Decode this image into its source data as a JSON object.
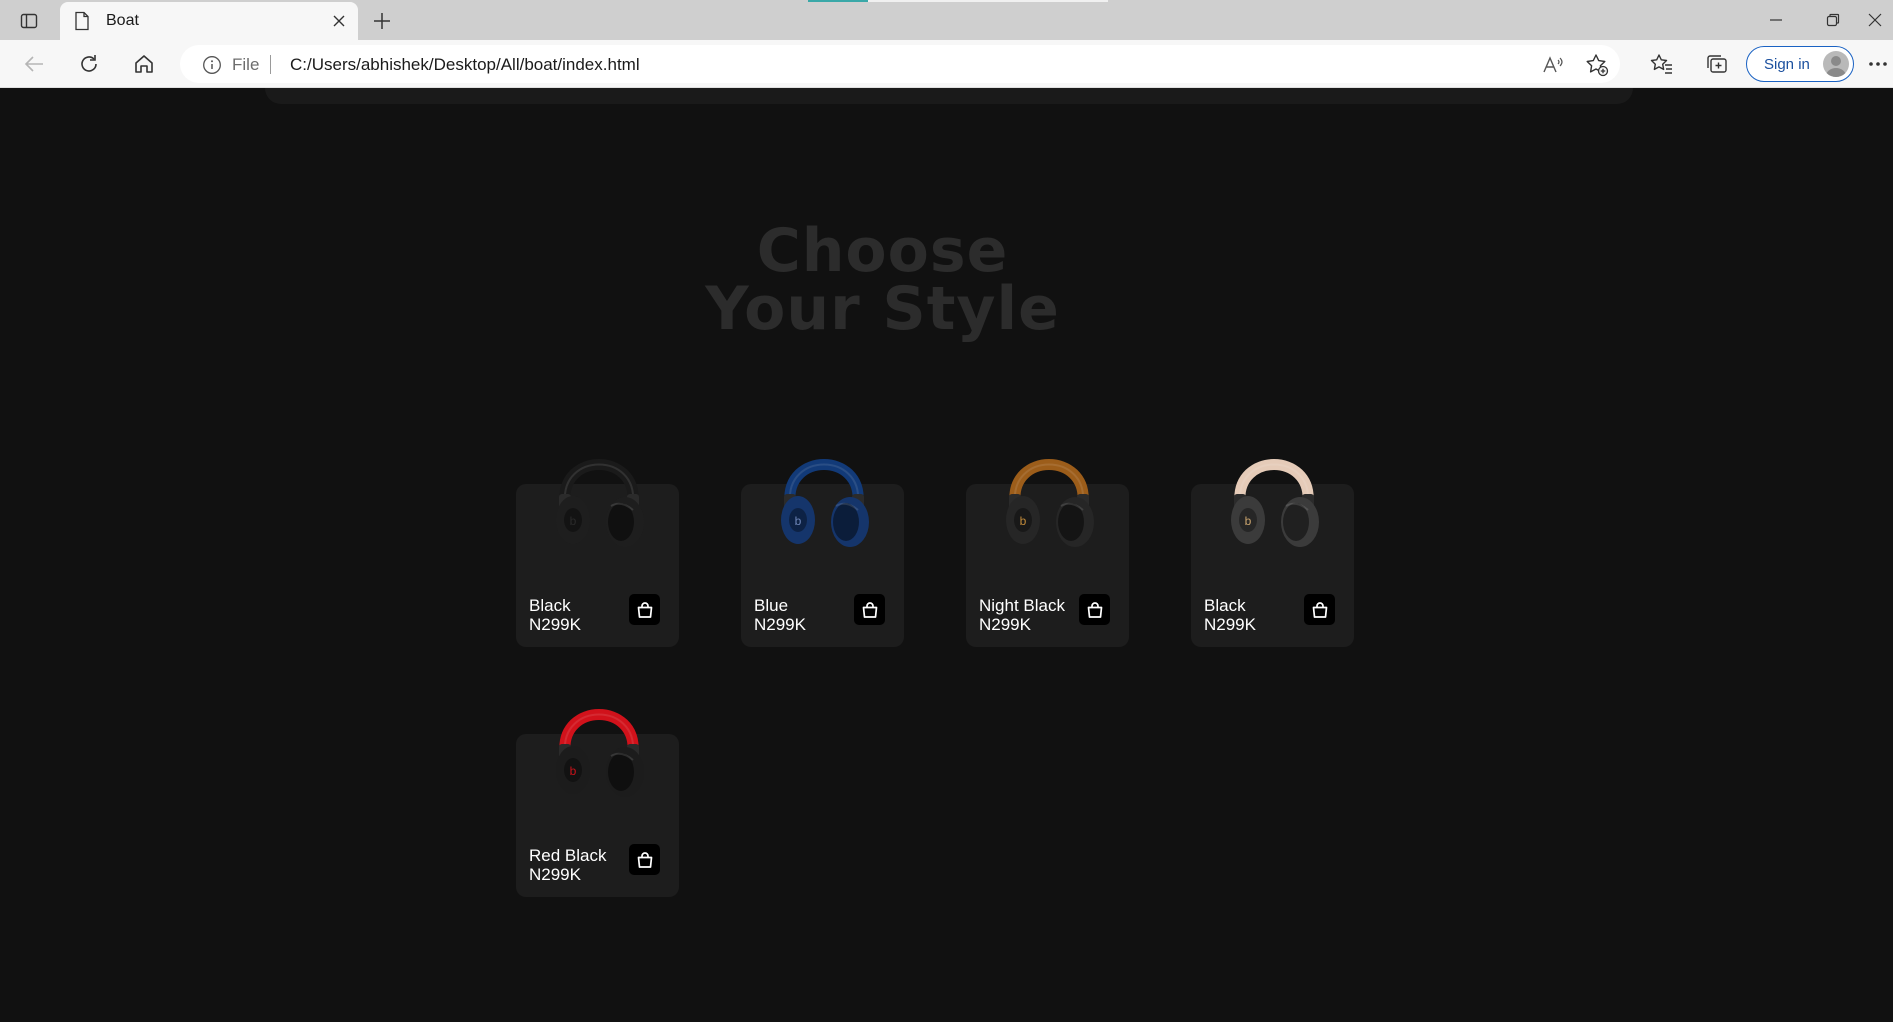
{
  "browser": {
    "tab_title": "Boat",
    "address_scheme_label": "File",
    "address_url": "C:/Users/abhishek/Desktop/All/boat/index.html",
    "sign_in_label": "Sign in",
    "icons": [
      "tab-actions-icon",
      "document-icon",
      "close-icon",
      "plus-icon",
      "minimize-icon",
      "restore-icon",
      "back-icon",
      "refresh-icon",
      "home-icon",
      "info-icon",
      "read-aloud-icon",
      "add-favorite-icon",
      "favorites-icon",
      "collections-icon",
      "avatar-icon",
      "more-icon"
    ]
  },
  "page": {
    "heading_line1": "Choose",
    "heading_line2": "Your Style",
    "colors": {
      "background": "#111111",
      "card": "#1d1d1d",
      "heading": "#2c2c2c",
      "text": "#ffffff"
    },
    "products": [
      {
        "name": "Black",
        "price": "N299K",
        "accent": "#1a1a1a",
        "cup": "#1e1e1e",
        "logo": "#2a2a2a"
      },
      {
        "name": "Blue",
        "price": "N299K",
        "accent": "#123a78",
        "cup": "#15356b",
        "logo": "#6e86b8"
      },
      {
        "name": "Night Black",
        "price": "N299K",
        "accent": "#9c5d1a",
        "cup": "#262626",
        "logo": "#c08a3a"
      },
      {
        "name": "Black",
        "price": "N299K",
        "accent": "#e5cbb8",
        "cup": "#3b3b3b",
        "logo": "#c9a36d"
      },
      {
        "name": "Red Black",
        "price": "N299K",
        "accent": "#d1121b",
        "cup": "#1c1c1c",
        "logo": "#c9121a"
      }
    ]
  }
}
